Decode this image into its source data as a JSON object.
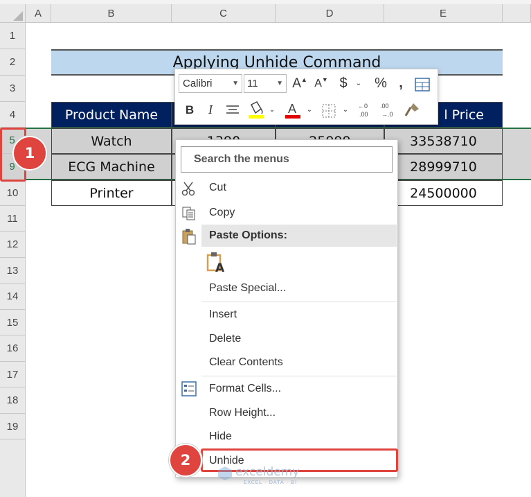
{
  "columns": [
    "A",
    "B",
    "C",
    "D",
    "E"
  ],
  "rows": [
    "1",
    "2",
    "3",
    "4",
    "5",
    "9",
    "10",
    "11",
    "12",
    "13",
    "14",
    "15",
    "16",
    "17",
    "18",
    "19"
  ],
  "title": "Applying Unhide Command",
  "table": {
    "header_first": "Product Name",
    "header_last": "l Price",
    "rows": [
      {
        "product": "Watch",
        "c": "1390",
        "d": "25999",
        "e": "33538710"
      },
      {
        "product": "ECG Machine",
        "c": "",
        "d": "",
        "e": "28999710"
      },
      {
        "product": "Printer",
        "c": "",
        "d": "",
        "e": "24500000"
      }
    ]
  },
  "mini_toolbar": {
    "font_name": "Calibri",
    "font_size": "11",
    "bold": "B",
    "italic": "I",
    "currency": "$",
    "percent": "%",
    "comma": ","
  },
  "context_menu": {
    "search_placeholder": "Search the menus",
    "cut": "Cut",
    "copy": "Copy",
    "paste_options": "Paste Options:",
    "paste_special": "Paste Special...",
    "insert": "Insert",
    "delete": "Delete",
    "clear_contents": "Clear Contents",
    "format_cells": "Format Cells...",
    "row_height": "Row Height...",
    "hide": "Hide",
    "unhide": "Unhide"
  },
  "badges": {
    "one": "1",
    "two": "2"
  },
  "watermark": {
    "brand": "exceldemy",
    "tagline": "EXCEL · DATA · BI"
  },
  "colors": {
    "header_fill": "#002060",
    "title_fill": "#bdd7ee",
    "badge_red": "#e0443e",
    "excel_green": "#217346"
  }
}
